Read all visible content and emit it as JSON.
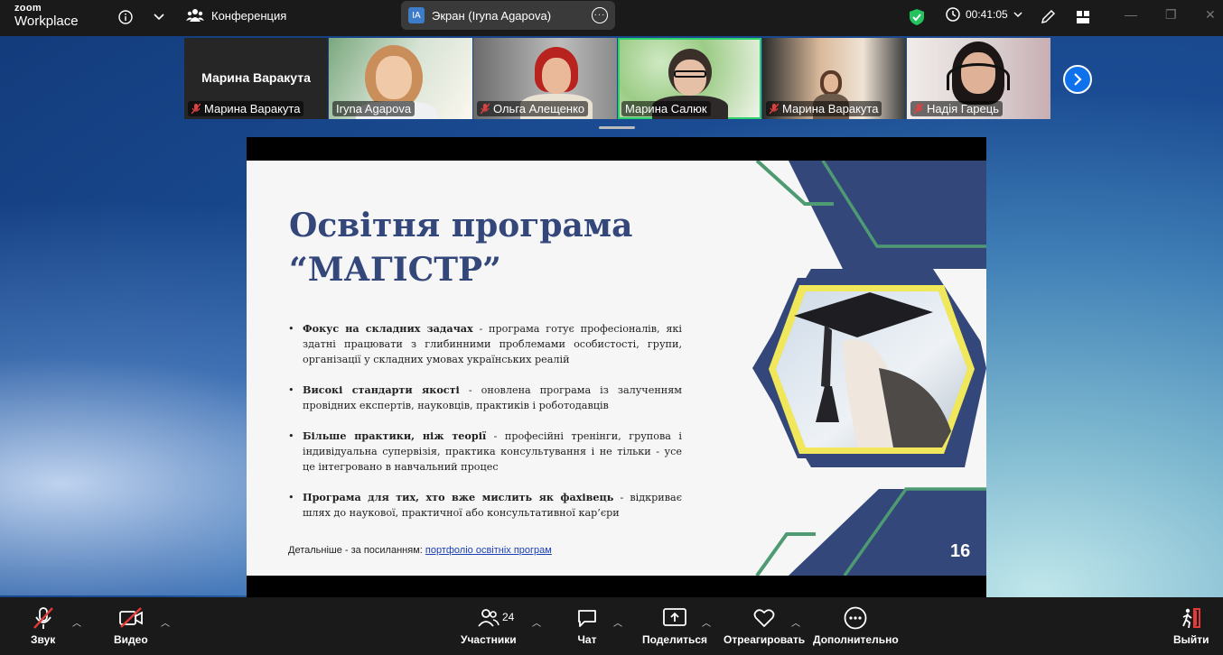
{
  "app": {
    "logo_top": "zoom",
    "logo_bottom": "Workplace"
  },
  "topbar": {
    "meeting_label": "Конференция",
    "screen_badge": "IA",
    "screen_label": "Экран (Iryna Agapova)",
    "timer": "00:41:05"
  },
  "participants": [
    {
      "name": "Марина Варакута",
      "big_name": "Марина Варакута",
      "muted": true,
      "video": false
    },
    {
      "name": "Iryna Agapova",
      "muted": false,
      "video": true
    },
    {
      "name": "Ольга Алещенко",
      "muted": true,
      "video": true
    },
    {
      "name": "Марина Салюк",
      "muted": false,
      "video": true,
      "active": true
    },
    {
      "name": "Марина Варакута",
      "muted": true,
      "video": true
    },
    {
      "name": "Надія Гарець",
      "muted": true,
      "video": true
    }
  ],
  "slide": {
    "title_line1": "Освітня програма",
    "title_line2": "“МАГІСТР”",
    "bullets": [
      {
        "bold": "Фокус на складних задачах",
        "text": " - програма готує професіоналів, які здатні працювати з глибинними проблемами особистості, групи, організації у складних умовах українських реалій"
      },
      {
        "bold": "Високі стандарти якості",
        "text": " - оновлена програма із залученням провідних експертів, науковців, практиків і роботодавців"
      },
      {
        "bold": "Більше практики, ніж теорії",
        "text": " - професійні тренінги, групова і індивідуальна супервізія, практика консультування і не тільки - усе це інтегровано в навчальний процес"
      },
      {
        "bold": "Програма для тих, хто вже мислить як фахівець",
        "text": " - відкриває шлях до наукової, практичної або консультативної кар’єри"
      }
    ],
    "more_prefix": "Детальніше - за посиланням: ",
    "more_link": "портфоліо освітніх програм",
    "page_number": "16",
    "colors": {
      "navy": "#34477a",
      "green": "#4e9a72",
      "yellow": "#f0e85a"
    }
  },
  "toolbar": {
    "audio": "Звук",
    "video": "Видео",
    "participants": "Участники",
    "participants_count": "24",
    "chat": "Чат",
    "share": "Поделиться",
    "react": "Отреагировать",
    "more": "Дополнительно",
    "leave": "Выйти"
  }
}
